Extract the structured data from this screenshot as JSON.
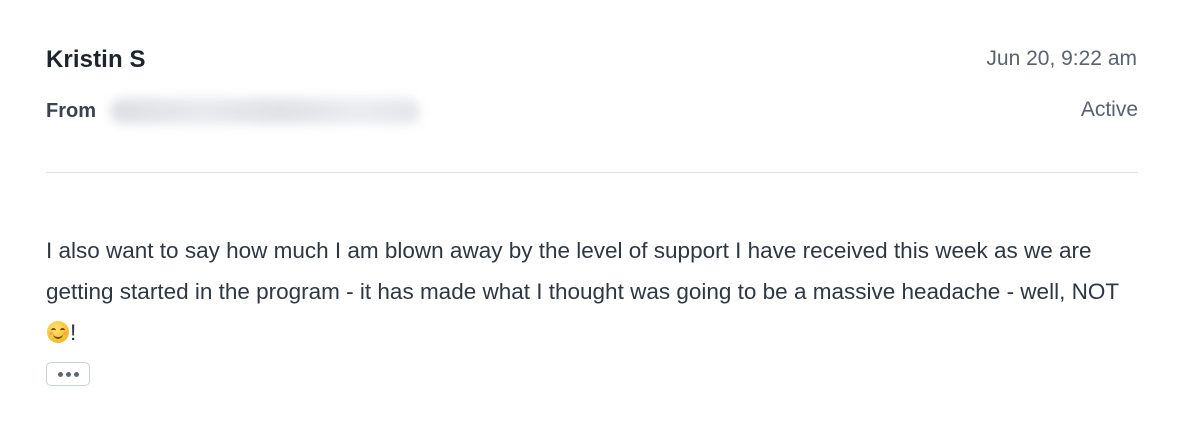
{
  "message": {
    "sender_name": "Kristin S",
    "timestamp": "Jun 20, 9:22 am",
    "from_label": "From",
    "status": "Active",
    "body_text": "I also want to say how much I am blown away by the level of support I have received this week as we are getting started in the program - it has made what I thought was going to be a massive headache - well, NOT",
    "body_suffix": "!",
    "emoji": "smiling-face-emoji"
  },
  "actions": {
    "more_icon": "ellipsis-icon"
  }
}
